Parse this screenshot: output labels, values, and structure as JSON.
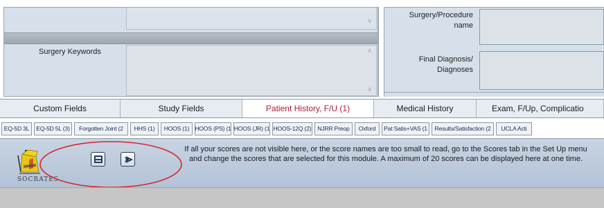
{
  "left_panel": {
    "surgery_keywords_label": "Surgery Keywords"
  },
  "right_panel": {
    "procedure_label_line1": "Surgery/Procedure",
    "procedure_label_line2": "name",
    "diagnosis_label_line1": "Final Diagnosis/",
    "diagnosis_label_line2": "Diagnoses"
  },
  "tabs_primary": [
    {
      "label": "Custom Fields",
      "active": false
    },
    {
      "label": "Study Fields",
      "active": false
    },
    {
      "label": "Patient History, F/U (1)",
      "active": true
    },
    {
      "label": "Medical History",
      "active": false
    },
    {
      "label": "Exam, F/Up, Complicatio",
      "active": false
    }
  ],
  "tabs_scores": [
    "EQ-5D 3L",
    "EQ-5D 5L (3)",
    "Forgotten Joint (2",
    "HHS (1)",
    "HOOS (1)",
    "HOOS (PS) (1",
    "HOOS (JR) (1",
    "HOOS-12Q (2)",
    "NJRR Preop",
    "Oxford",
    "Pat Satis+VAS (1",
    "Results/Satisfaction (2",
    "UCLA Acti"
  ],
  "toolbar": {
    "logo_text": "SOCRATES",
    "message": "If all your scores are not visible here, or the score names are too small to read, go to the Scores tab in the Set Up menu and change the scores that are selected for this module. A maximum of 20 scores can be displayed here at one time."
  },
  "colors": {
    "panel_bg": "#d6e0ea",
    "active_tab_text": "#b0173a",
    "toolbar_bg": "#b9c8da",
    "annotation_ellipse": "#d8252a"
  }
}
